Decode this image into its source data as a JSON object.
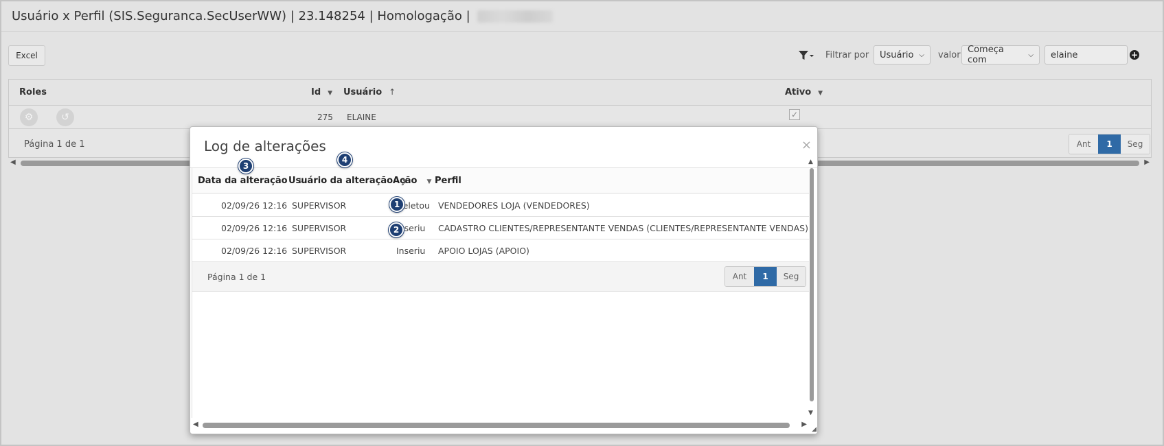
{
  "window": {
    "title": "Usuário x Perfil (SIS.Seguranca.SecUserWW) | 23.148254 | Homologação |"
  },
  "toolbar": {
    "excel_label": "Excel",
    "filter_by_label": "Filtrar por",
    "filter_field_value": "Usuário",
    "value_label": "valor",
    "operator_value": "Começa com",
    "search_value": "elaine"
  },
  "grid": {
    "columns": {
      "roles": "Roles",
      "id": "Id",
      "usuario": "Usuário",
      "ativo": "Ativo"
    },
    "row": {
      "id": "275",
      "usuario": "ELAINE",
      "ativo": true
    },
    "page_info": "Página 1 de 1",
    "pager": {
      "prev": "Ant",
      "current": "1",
      "next": "Seg"
    }
  },
  "modal": {
    "title": "Log de alterações",
    "close": "×",
    "columns": {
      "data": "Data da alteração",
      "usuario": "Usuário da alteração",
      "acao": "Ação",
      "perfil": "Perfil"
    },
    "rows": [
      {
        "data": "02/09/26 12:16",
        "usuario": "SUPERVISOR",
        "acao": "Deletou",
        "perfil": "VENDEDORES LOJA (VENDEDORES)"
      },
      {
        "data": "02/09/26 12:16",
        "usuario": "SUPERVISOR",
        "acao": "Inseriu",
        "perfil": "CADASTRO CLIENTES/REPRESENTANTE VENDAS (CLIENTES/REPRESENTANTE VENDAS)"
      },
      {
        "data": "02/09/26 12:16",
        "usuario": "SUPERVISOR",
        "acao": "Inseriu",
        "perfil": "APOIO LOJAS (APOIO)"
      }
    ],
    "page_info": "Página 1 de 1",
    "pager": {
      "prev": "Ant",
      "current": "1",
      "next": "Seg"
    }
  },
  "annotations": [
    "1",
    "2",
    "3",
    "4"
  ],
  "colors": {
    "accent": "#2f6aa6",
    "badge": "#1e3f73"
  }
}
